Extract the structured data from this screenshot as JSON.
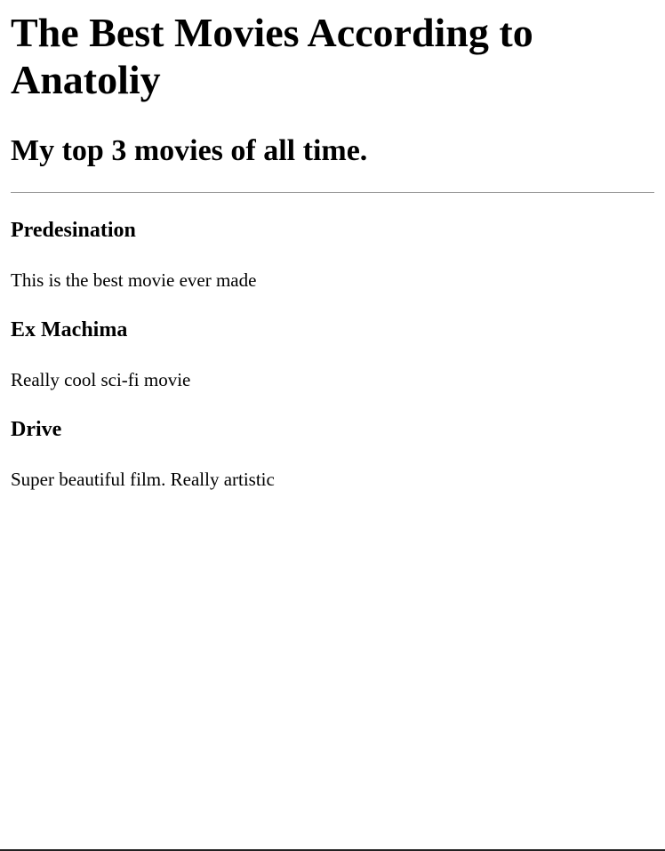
{
  "page": {
    "title": "The Best Movies According to Anatoliy",
    "subtitle": "My top 3 movies of all time."
  },
  "movies": [
    {
      "name": "Predesination",
      "description": "This is the best movie ever made"
    },
    {
      "name": "Ex Machima",
      "description": "Really cool sci-fi movie"
    },
    {
      "name": "Drive",
      "description": "Super beautiful film. Really artistic"
    }
  ]
}
